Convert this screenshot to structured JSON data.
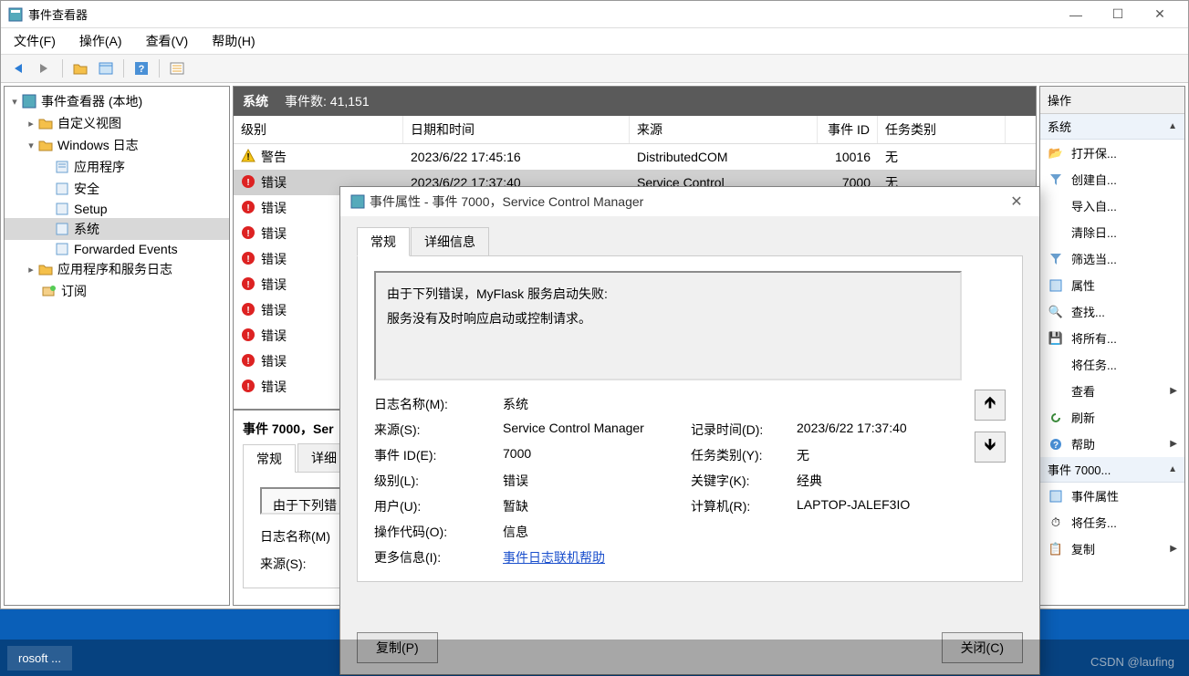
{
  "window": {
    "title": "事件查看器",
    "min": "—",
    "max": "☐",
    "close": "✕"
  },
  "menu": {
    "file": "文件(F)",
    "action": "操作(A)",
    "view": "查看(V)",
    "help": "帮助(H)"
  },
  "tree": {
    "root": "事件查看器 (本地)",
    "custom": "自定义视图",
    "winlogs": "Windows 日志",
    "app": "应用程序",
    "security": "安全",
    "setup": "Setup",
    "system": "系统",
    "forwarded": "Forwarded Events",
    "appsvc": "应用程序和服务日志",
    "sub": "订阅"
  },
  "grid": {
    "title": "系统",
    "count": "事件数: 41,151",
    "cols": {
      "level": "级别",
      "date": "日期和时间",
      "source": "来源",
      "id": "事件 ID",
      "task": "任务类别"
    },
    "rows": [
      {
        "icon": "warn",
        "level": "警告",
        "date": "2023/6/22 17:45:16",
        "source": "DistributedCOM",
        "id": "10016",
        "task": "无"
      },
      {
        "icon": "err",
        "level": "错误",
        "date": "2023/6/22 17:37:40",
        "source": "Service Control",
        "id": "7000",
        "task": "无",
        "selected": true
      },
      {
        "icon": "err",
        "level": "错误",
        "date": "",
        "source": "",
        "id": "",
        "task": ""
      },
      {
        "icon": "err",
        "level": "错误",
        "date": "",
        "source": "",
        "id": "",
        "task": ""
      },
      {
        "icon": "err",
        "level": "错误",
        "date": "",
        "source": "",
        "id": "",
        "task": ""
      },
      {
        "icon": "err",
        "level": "错误",
        "date": "",
        "source": "",
        "id": "",
        "task": ""
      },
      {
        "icon": "err",
        "level": "错误",
        "date": "",
        "source": "",
        "id": "",
        "task": ""
      },
      {
        "icon": "err",
        "level": "错误",
        "date": "",
        "source": "",
        "id": "",
        "task": ""
      },
      {
        "icon": "err",
        "level": "错误",
        "date": "",
        "source": "",
        "id": "",
        "task": ""
      },
      {
        "icon": "err",
        "level": "错误",
        "date": "",
        "source": "",
        "id": "",
        "task": ""
      }
    ]
  },
  "detail": {
    "title": "事件 7000，Ser",
    "tab1": "常规",
    "tab2": "详细",
    "line1": "由于下列错",
    "label_log": "日志名称(M)",
    "label_source": "来源(S):"
  },
  "actions": {
    "header": "操作",
    "section1": "系统",
    "open": "打开保...",
    "create": "创建自...",
    "import": "导入自...",
    "clear": "清除日...",
    "filter": "筛选当...",
    "props": "属性",
    "find": "查找...",
    "saveall": "将所有...",
    "attach": "将任务...",
    "view": "查看",
    "refresh": "刷新",
    "help": "帮助",
    "section2": "事件 7000...",
    "evprops": "事件属性",
    "evattach": "将任务...",
    "copy": "复制"
  },
  "dialog": {
    "title": "事件属性 - 事件 7000，Service Control Manager",
    "tab_general": "常规",
    "tab_detail": "详细信息",
    "desc1": "由于下列错误，MyFlask 服务启动失败:",
    "desc2": "服务没有及时响应启动或控制请求。",
    "labels": {
      "logname": "日志名称(M):",
      "source": "来源(S):",
      "eventid": "事件 ID(E):",
      "level": "级别(L):",
      "user": "用户(U):",
      "opcode": "操作代码(O):",
      "moreinfo": "更多信息(I):",
      "logged": "记录时间(D):",
      "taskcat": "任务类别(Y):",
      "keywords": "关键字(K):",
      "computer": "计算机(R):"
    },
    "values": {
      "logname": "系统",
      "source": "Service Control Manager",
      "eventid": "7000",
      "level": "错误",
      "user": "暂缺",
      "opcode": "信息",
      "logged": "2023/6/22 17:37:40",
      "taskcat": "无",
      "keywords": "经典",
      "computer": "LAPTOP-JALEF3IO"
    },
    "link": "事件日志联机帮助",
    "btn_copy": "复制(P)",
    "btn_close": "关闭(C)"
  },
  "taskbar": {
    "item": "rosoft ..."
  },
  "watermark": "CSDN @laufing"
}
